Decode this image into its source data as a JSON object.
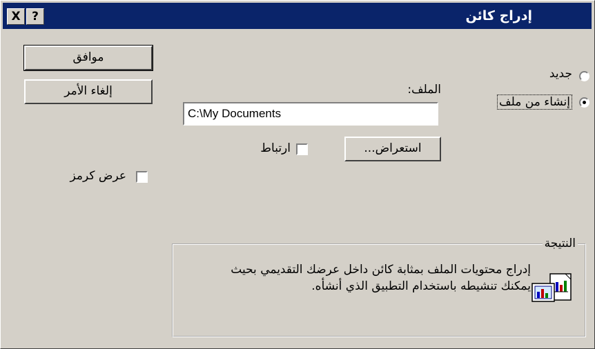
{
  "window": {
    "title": "إدراج كائن",
    "help_glyph": "?",
    "close_glyph": "X"
  },
  "options": {
    "new_label": "جديد",
    "from_file_label": "إنشاء من ملف",
    "selected": "from_file"
  },
  "file": {
    "label": "الملف:",
    "value": "C:\\My Documents",
    "browse_label": "استعراض..."
  },
  "link": {
    "label": "ارتباط",
    "checked": false
  },
  "buttons": {
    "ok_label": "موافق",
    "cancel_label": "إلغاء الأمر"
  },
  "display_as_icon": {
    "label": "عرض كرمز",
    "checked": false
  },
  "result": {
    "title": "النتيجة",
    "text": "إدراج محتويات الملف بمثابة كائن داخل عرضك التقديمي بحيث يمكنك تنشيطه باستخدام التطبيق الذي أنشأه.",
    "icon": "embedded-object-icon"
  }
}
